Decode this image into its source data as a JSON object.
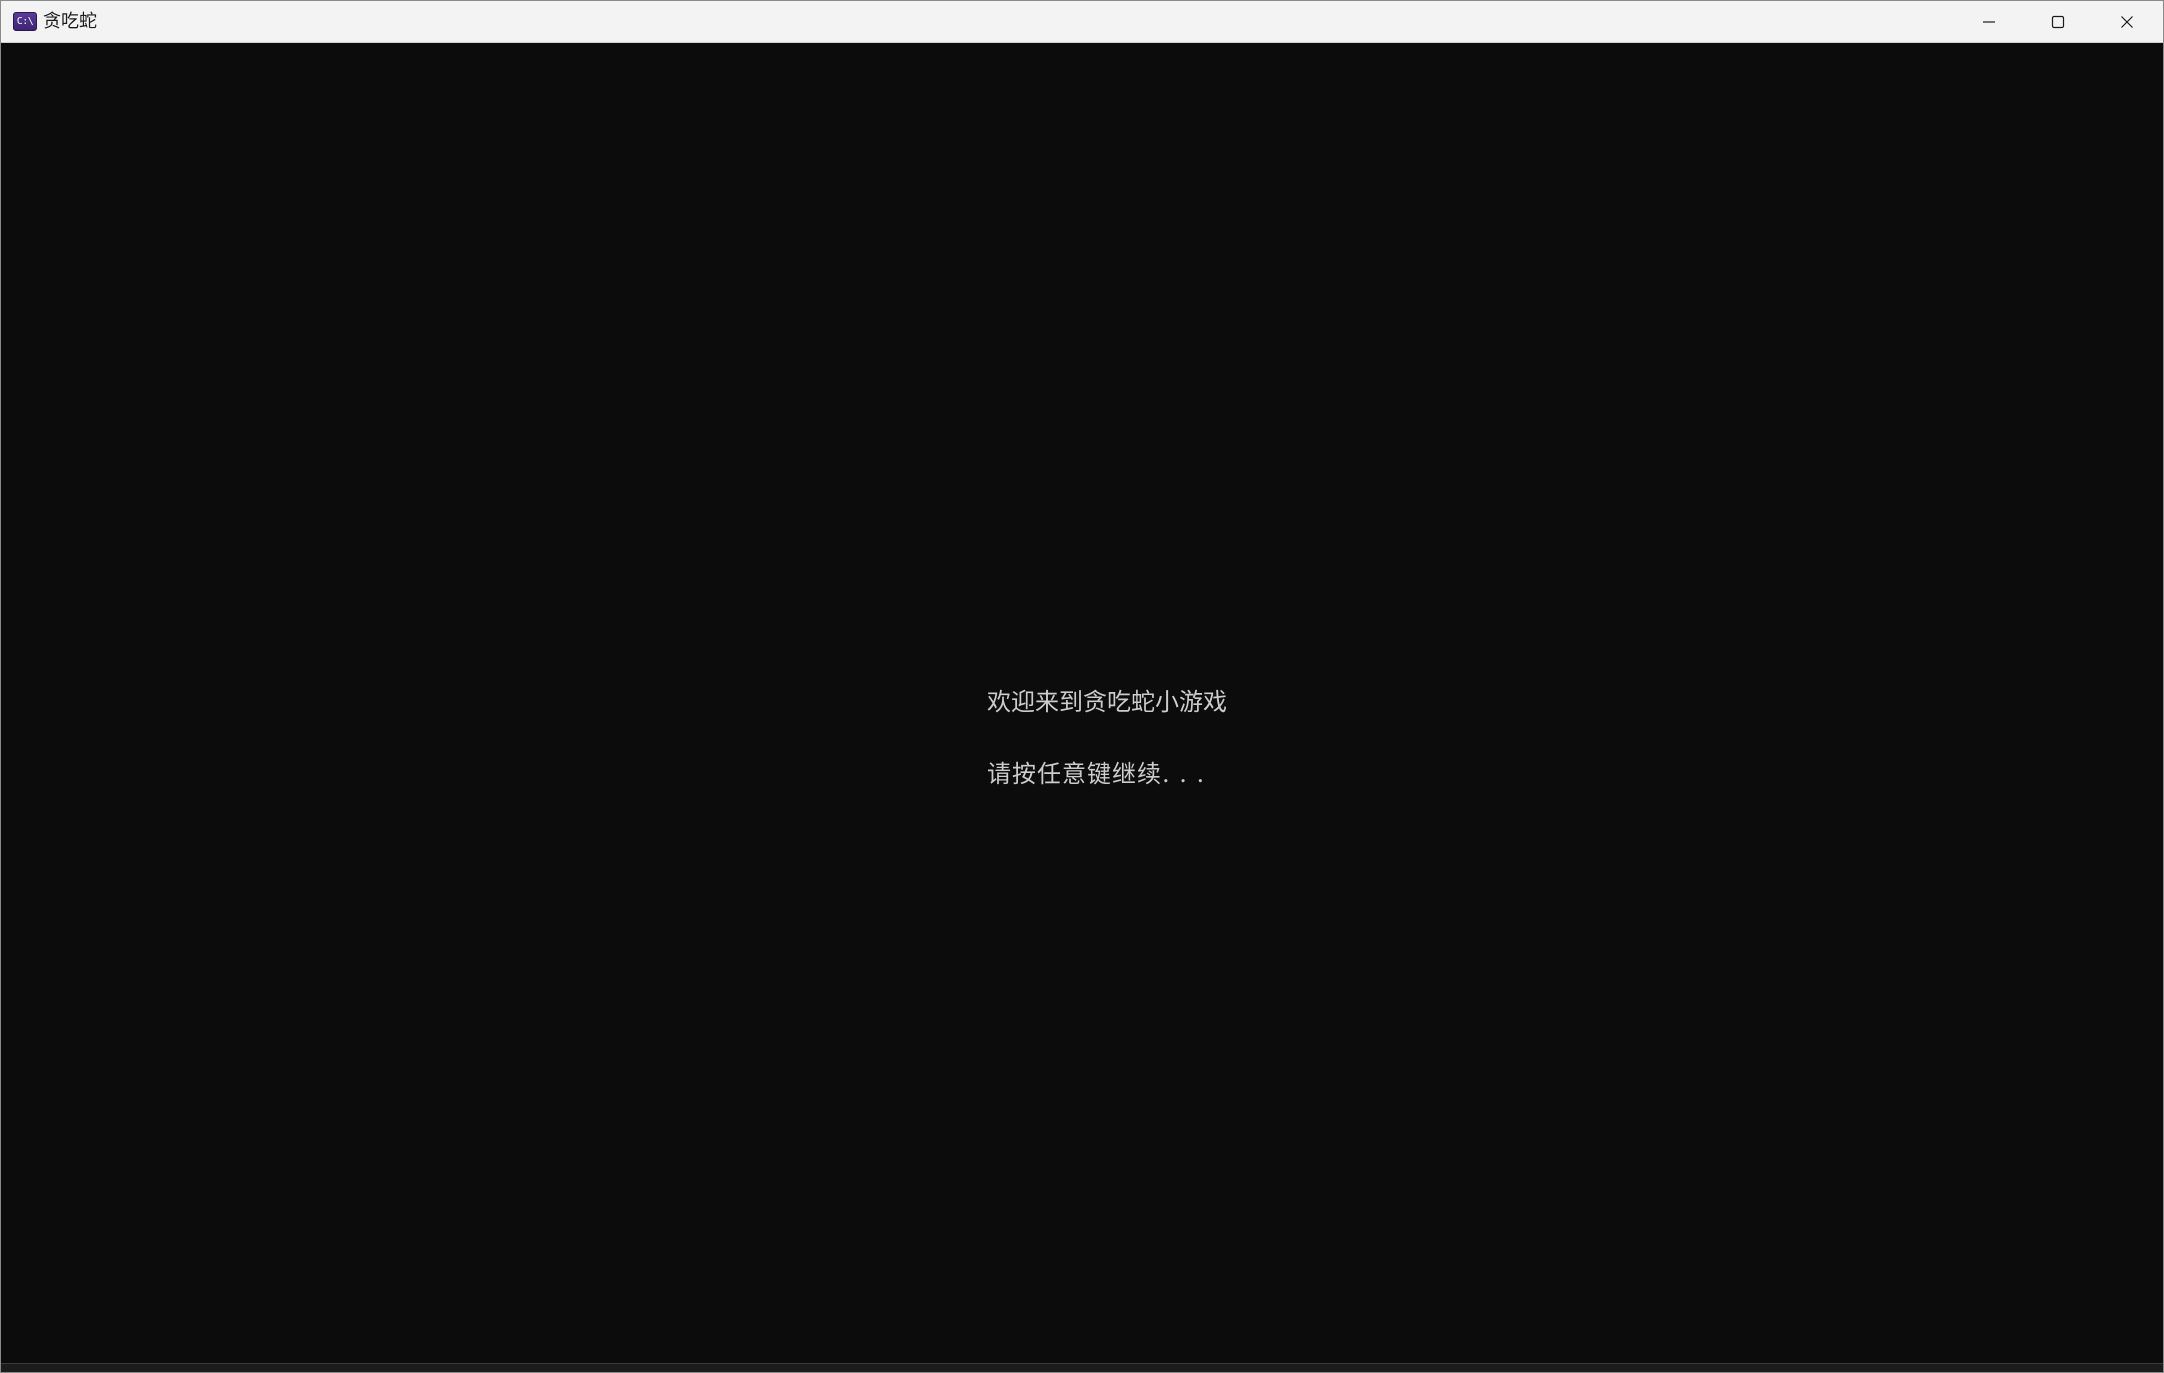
{
  "window": {
    "title": "贪吃蛇",
    "icon": "console-icon",
    "icon_glyph": "C:\\"
  },
  "caption_buttons": {
    "minimize_icon": "minimize-icon",
    "maximize_icon": "maximize-icon",
    "close_icon": "close-icon"
  },
  "console": {
    "lines": [
      "欢迎来到贪吃蛇小游戏",
      "请按任意键继续. . ."
    ],
    "background": "#0c0c0c",
    "text_color": "#cccccc"
  }
}
